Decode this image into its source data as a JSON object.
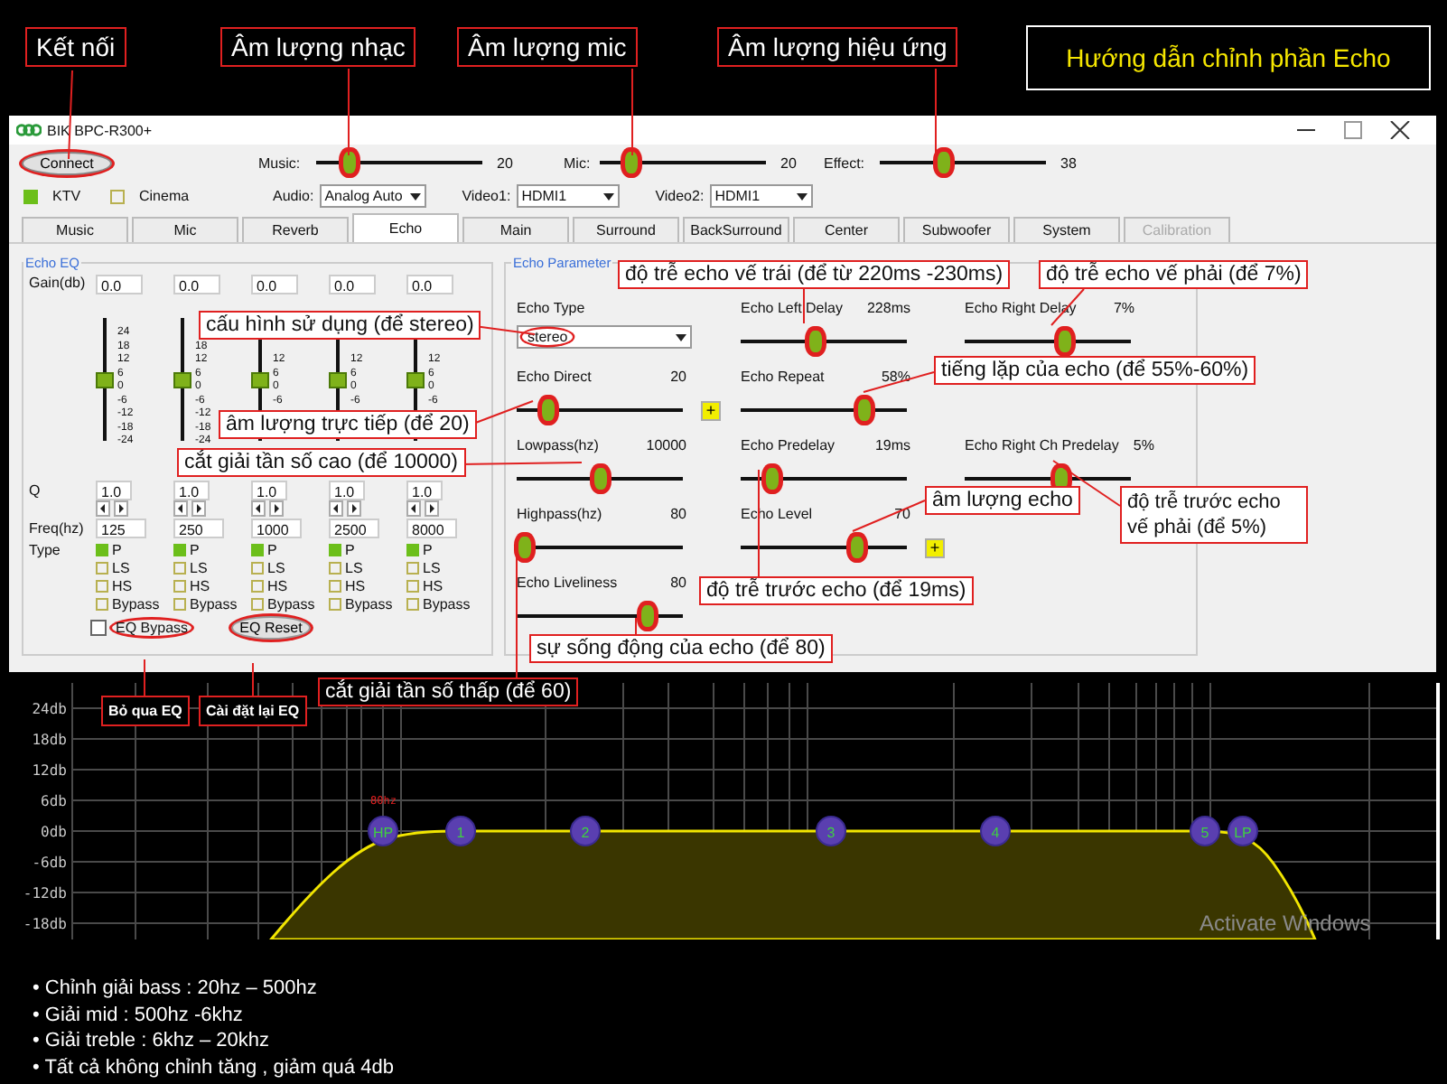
{
  "guide_title": "Hướng dẫn chỉnh phần Echo",
  "window": {
    "title": "BIK BPC-R300+"
  },
  "connect_button": {
    "label": "Connect",
    "circled": true
  },
  "volume_sliders": [
    {
      "label": "Music:",
      "level": 0.2,
      "reading": "20",
      "circled": true
    },
    {
      "label": "Mic:",
      "level": 0.18,
      "reading": "20",
      "circled": true
    },
    {
      "label": "Effect:",
      "level": 0.38,
      "reading": "38",
      "circled": true
    }
  ],
  "modes": [
    {
      "label": "KTV",
      "checked": true
    },
    {
      "label": "Cinema",
      "checked": false
    }
  ],
  "selects": [
    {
      "label": "Audio:",
      "value": "Analog Auto"
    },
    {
      "label": "Video1:",
      "value": "HDMI1"
    },
    {
      "label": "Video2:",
      "value": "HDMI1"
    }
  ],
  "tabs": [
    {
      "label": "Music",
      "selected": false,
      "disabled": false
    },
    {
      "label": "Mic",
      "selected": false,
      "disabled": false
    },
    {
      "label": "Reverb",
      "selected": false,
      "disabled": false
    },
    {
      "label": "Echo",
      "selected": true,
      "disabled": false
    },
    {
      "label": "Main",
      "selected": false,
      "disabled": false
    },
    {
      "label": "Surround",
      "selected": false,
      "disabled": false
    },
    {
      "label": "BackSurround",
      "selected": false,
      "disabled": false
    },
    {
      "label": "Center",
      "selected": false,
      "disabled": false
    },
    {
      "label": "Subwoofer",
      "selected": false,
      "disabled": false
    },
    {
      "label": "System",
      "selected": false,
      "disabled": false
    },
    {
      "label": "Calibration",
      "selected": false,
      "disabled": true
    }
  ],
  "echo_eq": {
    "title": "Echo EQ",
    "gain_label": "Gain(db)",
    "q_label": "Q",
    "freq_label": "Freq(hz)",
    "type_label": "Type",
    "bands": [
      {
        "gain": "0.0",
        "level": 0.5,
        "scale": [
          "24",
          "18",
          "12",
          "6",
          "0",
          "-6",
          "-12",
          "-18",
          "-24"
        ],
        "q": "1.0",
        "freq": "125",
        "types": [
          {
            "label": "P",
            "checked": true
          },
          {
            "label": "LS",
            "checked": false
          },
          {
            "label": "HS",
            "checked": false
          },
          {
            "label": "Bypass",
            "checked": false
          }
        ]
      },
      {
        "gain": "0.0",
        "level": 0.5,
        "scale": [
          "18",
          "12",
          "6",
          "0",
          "-6",
          "-12",
          "-18",
          "-24"
        ],
        "q": "1.0",
        "freq": "250",
        "types": [
          {
            "label": "P",
            "checked": true
          },
          {
            "label": "LS",
            "checked": false
          },
          {
            "label": "HS",
            "checked": false
          },
          {
            "label": "Bypass",
            "checked": false
          }
        ]
      },
      {
        "gain": "0.0",
        "level": 0.5,
        "scale": [
          "12",
          "6",
          "0",
          "-6"
        ],
        "q": "1.0",
        "freq": "1000",
        "types": [
          {
            "label": "P",
            "checked": true
          },
          {
            "label": "LS",
            "checked": false
          },
          {
            "label": "HS",
            "checked": false
          },
          {
            "label": "Bypass",
            "checked": false
          }
        ]
      },
      {
        "gain": "0.0",
        "level": 0.5,
        "scale": [
          "12",
          "6",
          "0",
          "-6"
        ],
        "q": "1.0",
        "freq": "2500",
        "types": [
          {
            "label": "P",
            "checked": true
          },
          {
            "label": "LS",
            "checked": false
          },
          {
            "label": "HS",
            "checked": false
          },
          {
            "label": "Bypass",
            "checked": false
          }
        ]
      },
      {
        "gain": "0.0",
        "level": 0.5,
        "scale": [
          "12",
          "6",
          "0",
          "-6"
        ],
        "q": "1.0",
        "freq": "8000",
        "types": [
          {
            "label": "P",
            "checked": true
          },
          {
            "label": "LS",
            "checked": false
          },
          {
            "label": "HS",
            "checked": false
          },
          {
            "label": "Bypass",
            "checked": false
          }
        ]
      }
    ],
    "bypass": {
      "label": "EQ Bypass",
      "checked": false,
      "circled": true
    },
    "reset": {
      "label": "EQ Reset",
      "circled": true
    }
  },
  "echo": {
    "title": "Echo Parameter",
    "rows": [
      {
        "cells": [
          {
            "kind": "select",
            "label": "Echo Type",
            "value": "stereo",
            "circled": true
          },
          {
            "kind": "slider",
            "label": "Echo Left Delay",
            "reading": "228ms",
            "level": 0.45,
            "circled": true
          },
          {
            "kind": "slider",
            "label": "Echo Right Delay",
            "reading": "7%",
            "level": 0.6,
            "circled": true
          }
        ]
      },
      {
        "cells": [
          {
            "kind": "slider",
            "label": "Echo Direct",
            "reading": "20",
            "level": 0.18,
            "circled": true,
            "plus": "+"
          },
          {
            "kind": "slider",
            "label": "Echo Repeat",
            "reading": "58%",
            "level": 0.74,
            "circled": true
          },
          {
            "kind": "blank"
          }
        ]
      },
      {
        "cells": [
          {
            "kind": "slider",
            "label": "Lowpass(hz)",
            "reading": "10000",
            "level": 0.5,
            "circled": true
          },
          {
            "kind": "slider",
            "label": "Echo Predelay",
            "reading": "19ms",
            "level": 0.18,
            "circled": true
          },
          {
            "kind": "slider",
            "label": "Echo Right Ch Predelay",
            "reading": "5%",
            "level": 0.58,
            "circled": true
          }
        ]
      },
      {
        "cells": [
          {
            "kind": "slider",
            "label": "Highpass(hz)",
            "reading": "80",
            "level": 0.04,
            "circled": true
          },
          {
            "kind": "slider",
            "label": "Echo Level",
            "reading": "70",
            "level": 0.7,
            "circled": true,
            "plus": "+"
          },
          {
            "kind": "blank"
          }
        ]
      },
      {
        "cells": [
          {
            "kind": "slider",
            "label": "Echo Liveliness",
            "reading": "80",
            "level": 0.78,
            "circled": true
          },
          {
            "kind": "blank"
          },
          {
            "kind": "blank"
          }
        ]
      }
    ]
  },
  "callouts": [
    {
      "kind": "heading",
      "text": "Kết nối"
    },
    {
      "kind": "heading",
      "text": "Âm lượng nhạc"
    },
    {
      "kind": "heading",
      "text": "Âm lượng mic"
    },
    {
      "kind": "heading",
      "text": "Âm lượng hiệu ứng"
    },
    {
      "kind": "note",
      "text": "độ trễ echo vế trái (để từ 220ms -230ms)"
    },
    {
      "kind": "note",
      "text": "độ trễ echo vế phải (để 7%)"
    },
    {
      "kind": "note",
      "text": "cấu hình sử dụng (để stereo)"
    },
    {
      "kind": "note",
      "text": "tiếng lặp của echo (để 55%-60%)"
    },
    {
      "kind": "note",
      "text": "âm lượng trực tiếp (để 20)"
    },
    {
      "kind": "note",
      "text": "cắt giải tần số cao (để 10000)"
    },
    {
      "kind": "note",
      "text": "âm lượng echo"
    },
    {
      "kind": "note",
      "text": "độ trễ trước echo vế phải (để 5%)"
    },
    {
      "kind": "note",
      "text": "độ trễ trước echo (để 19ms)"
    },
    {
      "kind": "note",
      "text": "sự sống động của echo (để 80)"
    },
    {
      "kind": "tag",
      "text": "cắt giải tần số thấp (để 60)"
    },
    {
      "kind": "mini",
      "text": "Bỏ qua EQ"
    },
    {
      "kind": "mini",
      "text": "Cài đặt lại EQ"
    }
  ],
  "eq_graph": {
    "y_labels": [
      "24db",
      "18db",
      "12db",
      "6db",
      "0db",
      "-6db",
      "-12db",
      "-18db"
    ],
    "marker_label": "80hz",
    "nodes": [
      {
        "label": "HP"
      },
      {
        "label": "1"
      },
      {
        "label": "2"
      },
      {
        "label": "3"
      },
      {
        "label": "4"
      },
      {
        "label": "5"
      },
      {
        "label": "LP"
      }
    ],
    "os_notice": "Activate Windows"
  },
  "notes": [
    "• Chỉnh giải bass : 20hz – 500hz",
    "• Giải mid : 500hz -6khz",
    "• Giải treble : 6khz – 20khz",
    "• Tất cả không chỉnh tăng , giảm quá 4db"
  ]
}
